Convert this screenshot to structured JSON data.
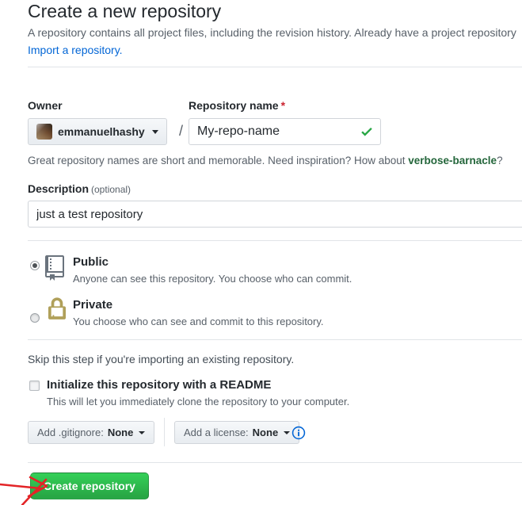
{
  "header": {
    "title": "Create a new repository",
    "intro_line1": "A repository contains all project files, including the revision history. Already have a project repository",
    "import_link": "Import a repository."
  },
  "owner": {
    "label": "Owner",
    "username": "emmanuelhashy",
    "caret_icon": "caret-down-icon",
    "avatar_icon": "user-avatar"
  },
  "separator": "/",
  "repo_name": {
    "label": "Repository name",
    "required_mark": "*",
    "value": "My-repo-name",
    "valid_icon": "check-icon"
  },
  "hint": {
    "text_before": "Great repository names are short and memorable. Need inspiration? How about ",
    "suggestion": "verbose-barnacle",
    "text_after": "?"
  },
  "description": {
    "label": "Description",
    "optional": "(optional)",
    "value": "just a test repository"
  },
  "visibility": {
    "public": {
      "label": "Public",
      "description": "Anyone can see this repository. You choose who can commit.",
      "selected": true,
      "icon": "repo-book-icon"
    },
    "private": {
      "label": "Private",
      "description": "You choose who can see and commit to this repository.",
      "selected": false,
      "icon": "lock-icon"
    }
  },
  "skip_note": "Skip this step if you're importing an existing repository.",
  "readme": {
    "label": "Initialize this repository with a README",
    "note": "This will let you immediately clone the repository to your computer.",
    "checked": false
  },
  "gitignore_button": {
    "prefix": "Add .gitignore:",
    "value": "None"
  },
  "license_button": {
    "prefix": "Add a license:",
    "value": "None"
  },
  "info_icon": "info-icon",
  "submit": {
    "label": "Create repository"
  },
  "annotation": {
    "type": "hand-drawn-red-arrow",
    "points_at": "Create repository button"
  },
  "colors": {
    "link_blue": "#0366d6",
    "suggestion_green": "#24663b",
    "button_green": "#28a745",
    "check_green": "#28a745",
    "required_red": "#cb2431",
    "lock_tan": "#b0a05a",
    "annotation_red": "#e32427"
  }
}
